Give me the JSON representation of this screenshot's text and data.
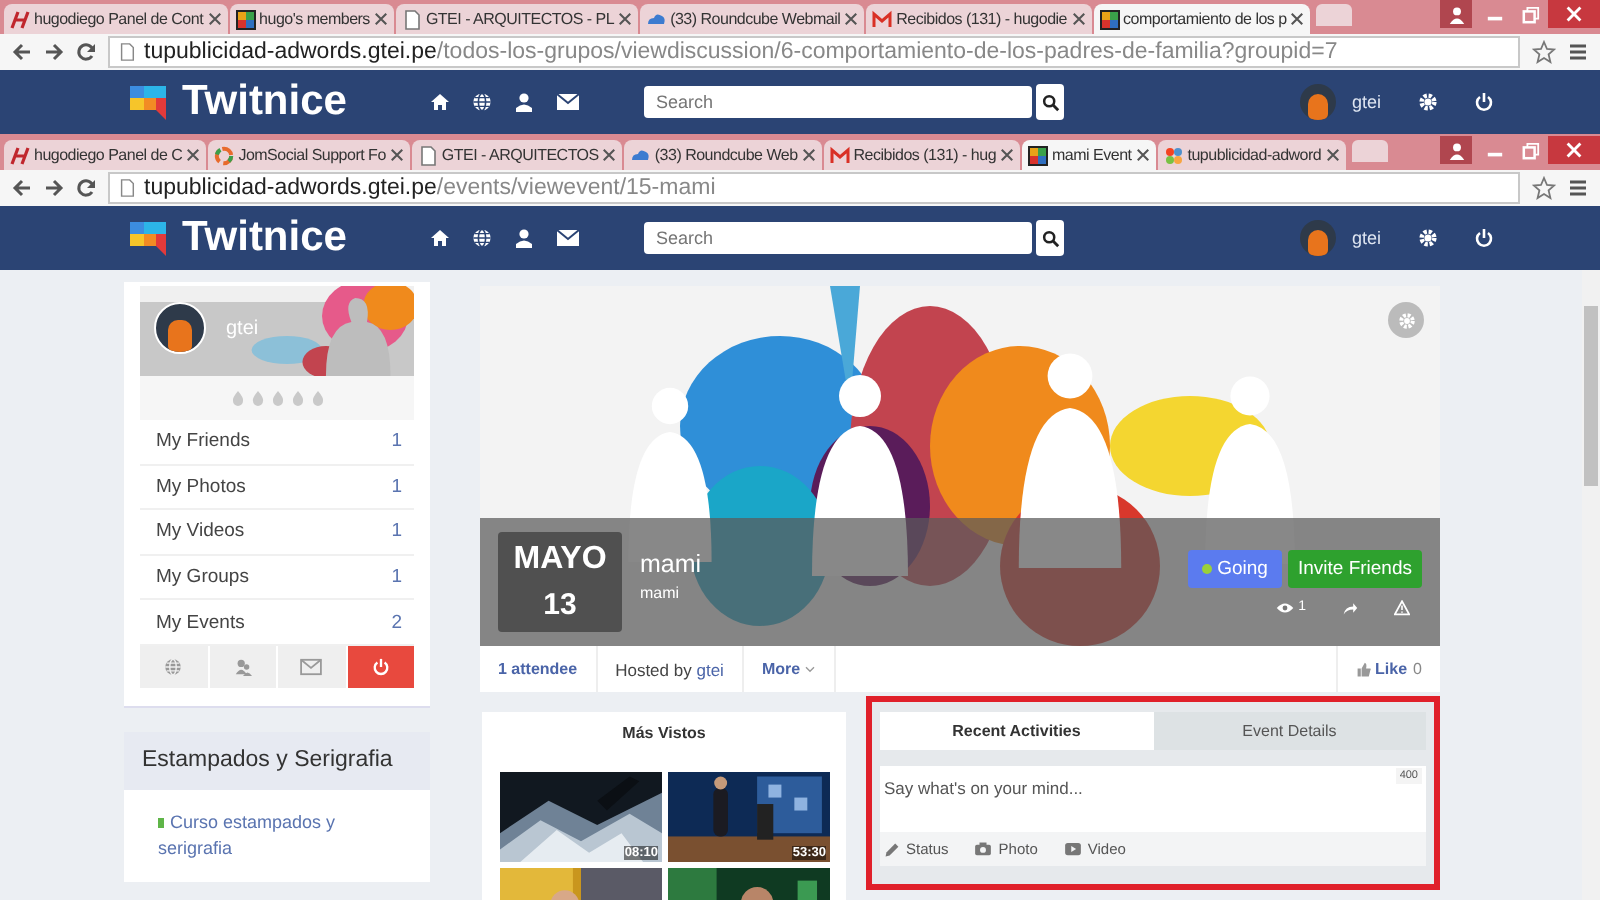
{
  "windows": [
    {
      "tabs": [
        {
          "title": "hugodiego Panel de Cont",
          "kind": "h-logo",
          "selected": false
        },
        {
          "title": "hugo's members",
          "kind": "tiles",
          "selected": false
        },
        {
          "title": "GTEI - ARQUITECTOS - PL",
          "kind": "page",
          "selected": false
        },
        {
          "title": "(33) Roundcube Webmail",
          "kind": "cloud",
          "selected": false
        },
        {
          "title": "Recibidos (131) - hugodie",
          "kind": "mail",
          "selected": false
        },
        {
          "title": "comportamiento de los p",
          "kind": "tiles",
          "selected": true
        }
      ],
      "address": {
        "host": "tupublicidad-adwords.gtei.pe",
        "path": "/todos-los-grupos/viewdiscussion/6-comportamiento-de-los-padres-de-familia?groupid=7"
      },
      "navbar": {
        "logo": "Twitnice",
        "search": {
          "placeholder": "Search"
        },
        "user": "gtei"
      }
    },
    {
      "tabs": [
        {
          "title": "hugodiego Panel de C",
          "kind": "h-logo",
          "selected": false
        },
        {
          "title": "JomSocial Support Fo",
          "kind": "ring",
          "selected": false
        },
        {
          "title": "GTEI - ARQUITECTOS",
          "kind": "page",
          "selected": false
        },
        {
          "title": "(33) Roundcube Web",
          "kind": "cloud",
          "selected": false
        },
        {
          "title": "Recibidos (131) - hug",
          "kind": "mail",
          "selected": false
        },
        {
          "title": "mami Event",
          "kind": "tiles",
          "selected": true
        },
        {
          "title": "tupublicidad-adword",
          "kind": "joomla",
          "selected": false
        }
      ],
      "address": {
        "host": "tupublicidad-adwords.gtei.pe",
        "path": "/events/viewevent/15-mami"
      },
      "navbar": {
        "logo": "Twitnice",
        "search": {
          "placeholder": "Search"
        },
        "user": "gtei"
      }
    }
  ],
  "sidebar": {
    "profile": {
      "name": "gtei"
    },
    "menu": [
      {
        "label": "My Friends",
        "count": "1"
      },
      {
        "label": "My Photos",
        "count": "1"
      },
      {
        "label": "My Videos",
        "count": "1"
      },
      {
        "label": "My Groups",
        "count": "1"
      },
      {
        "label": "My Events",
        "count": "2"
      }
    ],
    "group": {
      "title": "Estampados y Serigrafia",
      "links": [
        "Curso estampados y serigrafia"
      ]
    }
  },
  "event": {
    "month": "MAYO",
    "day": "13",
    "title": "mami",
    "subtitle": "mami",
    "going": "Going",
    "invite": "Invite Friends",
    "views": "1",
    "attendees": "1 attendee",
    "hosted_by": "Hosted by",
    "host": "gtei",
    "more": "More",
    "like": "Like",
    "likes": "0"
  },
  "most_viewed": {
    "title": "Más Vistos",
    "videos": [
      {
        "kind": "picture",
        "duration": "08:10"
      },
      {
        "kind": "picture",
        "duration": "53:30"
      },
      {
        "kind": "picture"
      },
      {
        "kind": "picture"
      }
    ]
  },
  "activity": {
    "tabs": [
      {
        "label": "Recent Activities",
        "selected": true
      },
      {
        "label": "Event Details",
        "selected": false
      }
    ],
    "composer": {
      "placeholder": "Say what's on your mind...",
      "counter": "400"
    },
    "actions": [
      {
        "kind": "status",
        "label": "Status"
      },
      {
        "label": "Photo"
      },
      {
        "kind": "video",
        "label": "Video"
      }
    ]
  }
}
